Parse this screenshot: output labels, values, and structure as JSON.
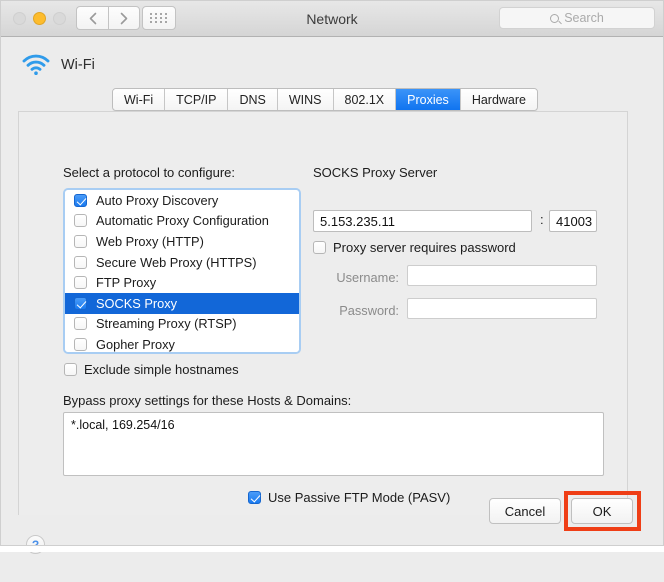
{
  "window": {
    "title": "Network",
    "traffic_lights": [
      "close",
      "minimize",
      "zoom"
    ],
    "nav_back_icon": "chevron-left-icon",
    "nav_forward_icon": "chevron-right-icon",
    "grid_icon": "show-all-icon"
  },
  "search": {
    "placeholder": "Search",
    "value": "",
    "icon": "search-icon"
  },
  "service": {
    "icon": "wifi-icon",
    "name": "Wi-Fi"
  },
  "tabs": [
    {
      "label": "Wi-Fi",
      "active": false
    },
    {
      "label": "TCP/IP",
      "active": false
    },
    {
      "label": "DNS",
      "active": false
    },
    {
      "label": "WINS",
      "active": false
    },
    {
      "label": "802.1X",
      "active": false
    },
    {
      "label": "Proxies",
      "active": true
    },
    {
      "label": "Hardware",
      "active": false
    }
  ],
  "protocols": {
    "label": "Select a protocol to configure:",
    "items": [
      {
        "label": "Auto Proxy Discovery",
        "checked": true,
        "selected": false
      },
      {
        "label": "Automatic Proxy Configuration",
        "checked": false,
        "selected": false
      },
      {
        "label": "Web Proxy (HTTP)",
        "checked": false,
        "selected": false
      },
      {
        "label": "Secure Web Proxy (HTTPS)",
        "checked": false,
        "selected": false
      },
      {
        "label": "FTP Proxy",
        "checked": false,
        "selected": false
      },
      {
        "label": "SOCKS Proxy",
        "checked": true,
        "selected": true
      },
      {
        "label": "Streaming Proxy (RTSP)",
        "checked": false,
        "selected": false
      },
      {
        "label": "Gopher Proxy",
        "checked": false,
        "selected": false
      }
    ]
  },
  "exclude_simple_hostnames": {
    "label": "Exclude simple hostnames",
    "checked": false
  },
  "socks": {
    "title": "SOCKS Proxy Server",
    "server": "5.153.235.11",
    "separator": ":",
    "port": "41003",
    "requires_password_label": "Proxy server requires password",
    "requires_password_checked": false,
    "username_label": "Username:",
    "username_value": "",
    "password_label": "Password:",
    "password_value": ""
  },
  "bypass": {
    "label": "Bypass proxy settings for these Hosts & Domains:",
    "value": "*.local, 169.254/16"
  },
  "passive_ftp": {
    "label": "Use Passive FTP Mode (PASV)",
    "checked": true
  },
  "footer": {
    "help_label": "?",
    "cancel_label": "Cancel",
    "ok_label": "OK"
  },
  "colors": {
    "accent_blue": "#1074f0",
    "selection_blue": "#1267d8",
    "highlight_red": "#ef3e16",
    "window_bg": "#ececec"
  }
}
